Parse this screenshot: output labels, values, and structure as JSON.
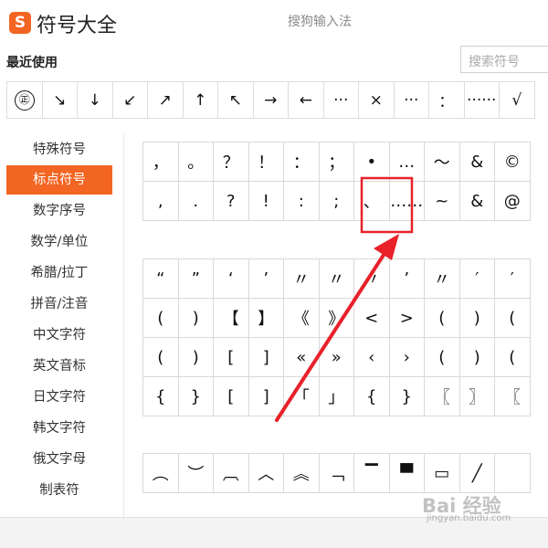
{
  "window": {
    "logo_glyph": "S",
    "title": "符号大全",
    "ime_name": "搜狗输入法"
  },
  "recent": {
    "label": "最近使用",
    "search_placeholder": "搜索符号",
    "symbols": [
      "㊣",
      "↘",
      "↓",
      "↙",
      "↗",
      "↑",
      "↖",
      "→",
      "←",
      "···",
      "×",
      "···",
      "：",
      "······",
      "√"
    ]
  },
  "sidebar": {
    "items": [
      {
        "label": "特殊符号",
        "active": false
      },
      {
        "label": "标点符号",
        "active": true
      },
      {
        "label": "数字序号",
        "active": false
      },
      {
        "label": "数学/单位",
        "active": false
      },
      {
        "label": "希腊/拉丁",
        "active": false
      },
      {
        "label": "拼音/注音",
        "active": false
      },
      {
        "label": "中文字符",
        "active": false
      },
      {
        "label": "英文音标",
        "active": false
      },
      {
        "label": "日文字符",
        "active": false
      },
      {
        "label": "韩文字符",
        "active": false
      },
      {
        "label": "俄文字母",
        "active": false
      },
      {
        "label": "制表符",
        "active": false
      }
    ]
  },
  "grids": [
    {
      "name": "punctuation-grid",
      "rows": [
        [
          "，",
          "。",
          "？",
          "！",
          "：",
          "；",
          "•",
          "…",
          "～",
          "&",
          "©"
        ],
        [
          ",",
          ".",
          "?",
          "!",
          ":",
          ";",
          "、",
          "……",
          "~",
          "&",
          "@"
        ]
      ]
    },
    {
      "name": "quotes-brackets-grid",
      "rows": [
        [
          "“",
          "”",
          "‘",
          "’",
          "〃",
          "〃",
          "〃",
          "’",
          "〃",
          "′",
          "′"
        ],
        [
          "(",
          ")",
          "【",
          "】",
          "《",
          "》",
          "<",
          ">",
          "(",
          ")",
          "("
        ],
        [
          "(",
          ")",
          "[",
          "]",
          "«",
          "»",
          "‹",
          "›",
          "(",
          ")",
          "("
        ],
        [
          "{",
          "}",
          "[",
          "]",
          "「",
          "」",
          "{",
          "}",
          "〖",
          "〗",
          "〖"
        ]
      ]
    },
    {
      "name": "box-drawing-grid",
      "rows": [
        [
          "︵",
          "︶",
          "︹",
          "︿",
          "︽",
          "﹁",
          "▔",
          "▀",
          "▭",
          "╱",
          ""
        ]
      ]
    }
  ],
  "highlight": {
    "cell_symbol": "、",
    "color": "#e8212a"
  },
  "watermark": {
    "text": "Bai 经验",
    "sub": "jingyan.baidu.com"
  },
  "colors": {
    "accent": "#f26522",
    "annotation": "#e8212a"
  }
}
